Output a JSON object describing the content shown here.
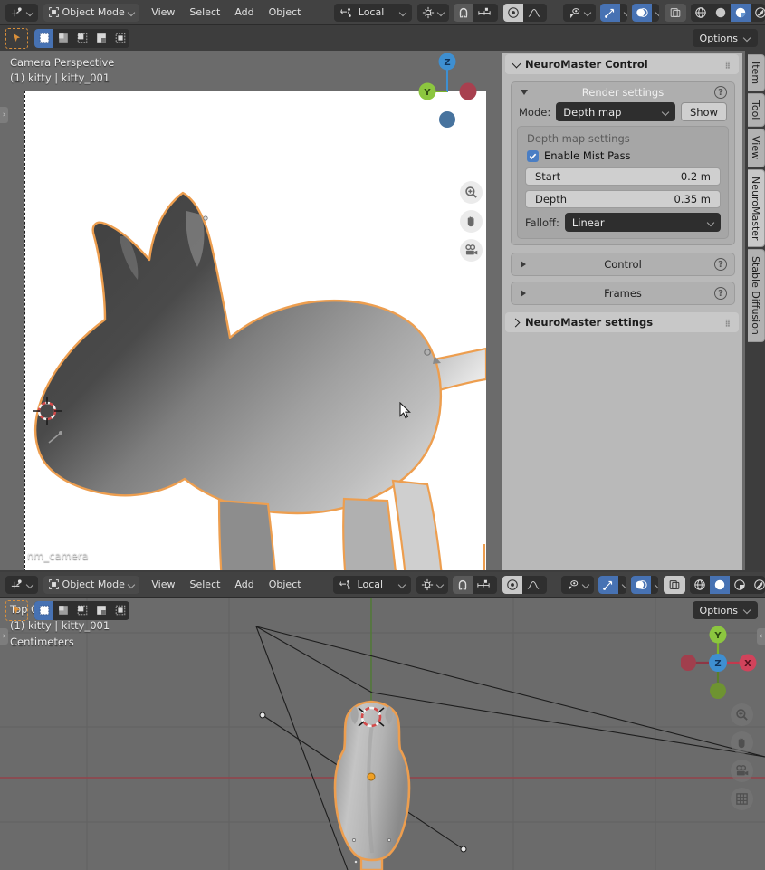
{
  "app": {
    "name": "Blender 3D Viewport"
  },
  "top_viewport": {
    "header": {
      "editor_type_icon": "editor-type-icon",
      "mode": "Object Mode",
      "menus": [
        "View",
        "Select",
        "Add",
        "Object"
      ],
      "orientation": "Local",
      "pivot_icon": "pivot-point-icon",
      "snap_magnet_icon": "snap-magnet-icon",
      "snap_icon": "snap-increment-icon",
      "proportional_icon": "proportional-edit-icon",
      "falloff_icon": "proportional-falloff-icon",
      "visibility_icon": "object-visibility-icon",
      "gizmo_icon": "gizmo-icon",
      "overlays_icon": "overlays-icon",
      "xray_icon": "xray-toggle-icon",
      "shading": [
        "wireframe",
        "solid",
        "material-preview",
        "rendered"
      ],
      "shading_active": "material-preview"
    },
    "row2": {
      "tweak_icon": "tweak-tool-icon",
      "select_modes": [
        "select-box",
        "select-box-extend",
        "select-box-subtract",
        "select-box-difference",
        "select-box-intersect"
      ],
      "select_mode_active": 0,
      "options_label": "Options"
    },
    "overlay": {
      "view_name": "Camera Perspective",
      "object_name": "(1) kitty | kitty_001",
      "camera_name": "nm_camera"
    },
    "gizmo": {
      "z_label": "Z",
      "y_label": "Y"
    },
    "nav_tools": [
      "zoom-icon",
      "hand-pan-icon",
      "camera-view-icon"
    ]
  },
  "bottom_viewport": {
    "header": {
      "mode": "Object Mode",
      "menus": [
        "View",
        "Select",
        "Add",
        "Object"
      ],
      "orientation": "Local",
      "shading_active": "solid"
    },
    "row2": {
      "options_label": "Options"
    },
    "overlay": {
      "view_name": "Top Orthographic",
      "object_name": "(1) kitty | kitty_001",
      "units": "Centimeters"
    },
    "gizmo": {
      "x_label": "X",
      "y_label": "Y",
      "z_label": "Z"
    },
    "nav_tools": [
      "zoom-icon",
      "hand-pan-icon",
      "camera-view-icon",
      "grid-toggle-icon"
    ]
  },
  "side_panel": {
    "title": "NeuroMaster Control",
    "render_settings": {
      "title": "Render settings",
      "mode_label": "Mode:",
      "mode_value": "Depth map",
      "show_button": "Show",
      "depth_map": {
        "title": "Depth map settings",
        "mist_label": "Enable Mist Pass",
        "mist_checked": true,
        "start_label": "Start",
        "start_value": "0.2 m",
        "depth_label": "Depth",
        "depth_value": "0.35 m",
        "falloff_label": "Falloff:",
        "falloff_value": "Linear"
      }
    },
    "control_panel": "Control",
    "frames_panel": "Frames",
    "settings_panel": "NeuroMaster settings",
    "tabs": [
      "Item",
      "Tool",
      "View",
      "NeuroMaster",
      "Stable Diffusion"
    ],
    "tab_active": "NeuroMaster"
  },
  "colors": {
    "accent_blue": "#4772b3",
    "selection_orange": "#ed9e4f",
    "axis_x_red": "#d1435b",
    "axis_y_green": "#8cc63f",
    "axis_z_blue": "#3e8fd1",
    "header_bg": "#424242",
    "viewport_bg": "#6b6b6b",
    "panel_bg": "#b9b9b9"
  }
}
